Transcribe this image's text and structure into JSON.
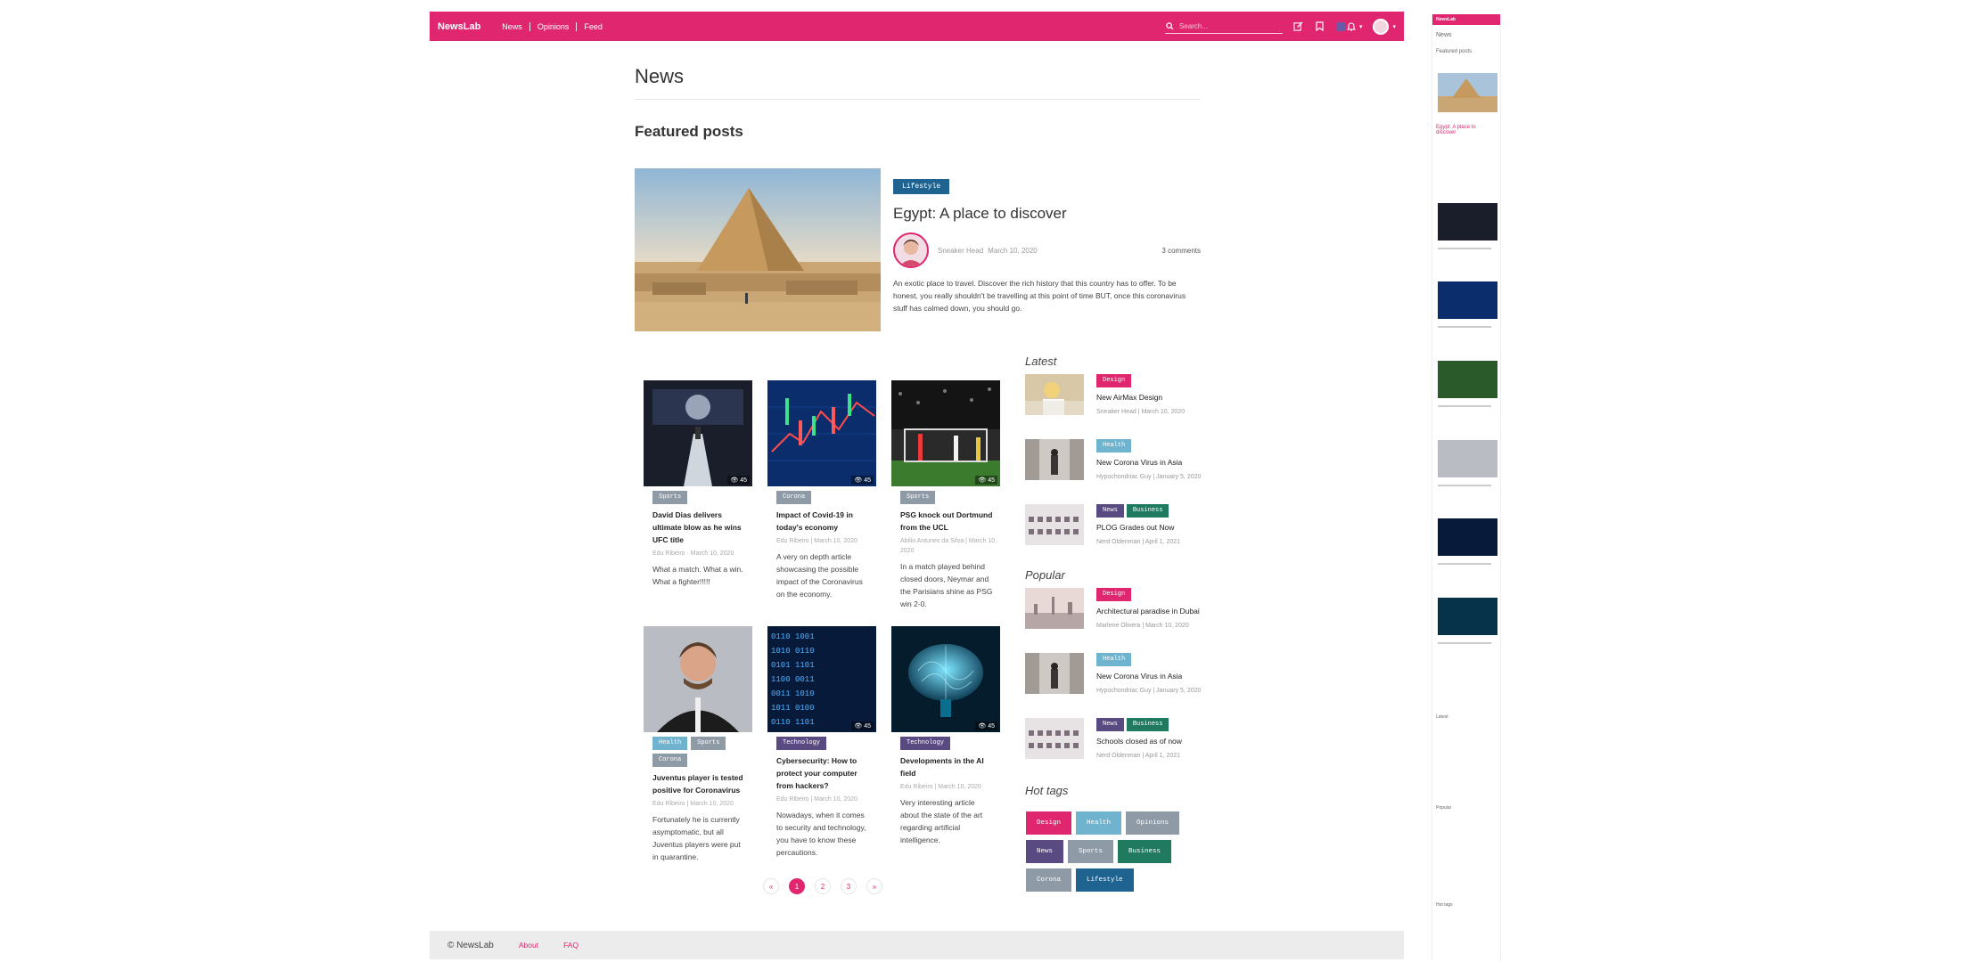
{
  "nav": {
    "brand": "NewsLab",
    "links": [
      "News",
      "Opinions",
      "Feed"
    ],
    "search_placeholder": "Search..."
  },
  "page": {
    "title": "News",
    "featured_heading": "Featured posts"
  },
  "featured": {
    "tag": "Lifestyle",
    "title": "Egypt: A place to discover",
    "author": "Sneaker Head",
    "date": "March 10, 2020",
    "comments": "3 comments",
    "excerpt": "An exotic place to travel. Discover the rich history that this country has to offer. To be honest, you really shouldn't be travelling at this point of time BUT, once this coronavirus stuff has calmed down, you should go."
  },
  "articles": [
    {
      "tags": [
        "Sports"
      ],
      "title": "David Dias delivers ultimate blow as he wins UFC title",
      "meta": "Edu Ribeiro · March 10, 2020",
      "excerpt": "What a match. What a win. What a fighter!!!!!",
      "views": "45"
    },
    {
      "tags": [
        "Corona"
      ],
      "title": "Impact of Covid-19 in today's economy",
      "meta": "Edu Ribeiro | March 10, 2020",
      "excerpt": "A very on depth article showcasing the possible impact of the Coronavirus on the economy.",
      "views": "45"
    },
    {
      "tags": [
        "Sports"
      ],
      "title": "PSG knock out Dortmund from the UCL",
      "meta": "Abilio Antunes da Silva | March 10, 2020",
      "excerpt": "In a match played behind closed doors, Neymar and the Parisians shine as PSG win 2-0.",
      "views": "45"
    },
    {
      "tags": [
        "Health",
        "Sports",
        "Corona"
      ],
      "title": "Juventus player is tested positive for Coronavirus",
      "meta": "Edu Ribeiro | March 10, 2020",
      "excerpt": "Fortunately he is currently asymptomatic, but all Juventus players were put in quarantine.",
      "views": "45"
    },
    {
      "tags": [
        "Technology"
      ],
      "title": "Cybersecurity: How to protect your computer from hackers?",
      "meta": "Edu Ribeiro | March 10, 2020",
      "excerpt": "Nowadays, when it comes to security and technology, you have to know these percautions.",
      "views": "45"
    },
    {
      "tags": [
        "Technology"
      ],
      "title": "Developments in the AI field",
      "meta": "Edu Ribeiro | March 10, 2020",
      "excerpt": "Very interesting article about the state of the art regarding artificial intelligence.",
      "views": "45"
    }
  ],
  "pagination": {
    "prev": "«",
    "pages": [
      "1",
      "2",
      "3"
    ],
    "next": "»",
    "current": "1"
  },
  "sidebar": {
    "latest_heading": "Latest",
    "latest": [
      {
        "tags": [
          "Design"
        ],
        "title": "New AirMax Design",
        "meta": "Sneaker Head | March 10, 2020"
      },
      {
        "tags": [
          "Health"
        ],
        "title": "New Corona Virus in Asia",
        "meta": "Hypochondriac Guy | January 5, 2020"
      },
      {
        "tags": [
          "News",
          "Business"
        ],
        "title": "PLOG Grades out Now",
        "meta": "Nerd Oldenman | April 1, 2021"
      }
    ],
    "popular_heading": "Popular",
    "popular": [
      {
        "tags": [
          "Design"
        ],
        "title": "Architectural paradise in Dubai",
        "meta": "Marlene Olivera | March 10, 2020"
      },
      {
        "tags": [
          "Health"
        ],
        "title": "New Corona Virus in Asia",
        "meta": "Hypochondriac Guy | January 5, 2020"
      },
      {
        "tags": [
          "News",
          "Business"
        ],
        "title": "Schools closed as of now",
        "meta": "Nerd Oldenman | April 1, 2021"
      }
    ],
    "hot_tags_heading": "Hot tags",
    "hot_tags": [
      "Design",
      "Health",
      "Opinions",
      "News",
      "Sports",
      "Business",
      "Corona",
      "Lifestyle"
    ]
  },
  "footer": {
    "copyright": "© NewsLab",
    "links": [
      "About",
      "FAQ"
    ]
  },
  "mini_preview": {
    "brand": "NewsLab",
    "page_title": "News",
    "featured_heading": "Featured posts",
    "featured_title": "Egypt: A place to discover",
    "latest_heading": "Latest",
    "popular_heading": "Popular",
    "hot_tags_heading": "Hot tags"
  },
  "tag_colors": {
    "Lifestyle": "#1f6391",
    "Sports": "#8e9aa6",
    "Corona": "#8e9aa6",
    "Health": "#6fb3cf",
    "Technology": "#5a4a82",
    "Design": "#e0266f",
    "News": "#5a4a82",
    "Business": "#1f7a5f",
    "Opinions": "#8e9aa6"
  },
  "colors": {
    "brand": "#e0266f",
    "footer_bg": "#ececec"
  }
}
